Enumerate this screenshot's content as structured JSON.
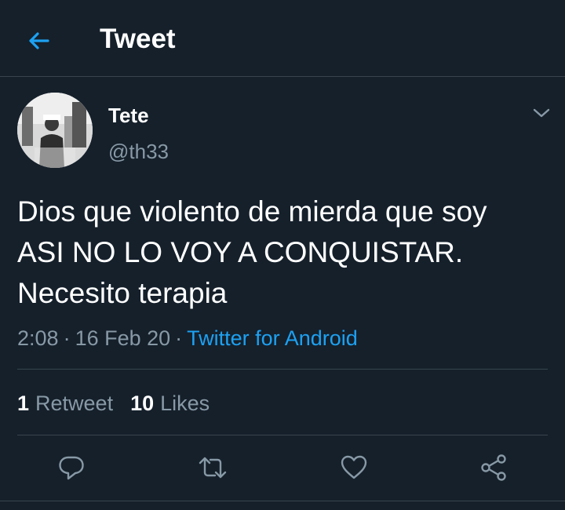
{
  "header": {
    "back_icon": "arrow-left-icon",
    "title": "Tweet"
  },
  "tweet": {
    "author_name": "Tete",
    "author_handle": "@th33",
    "text": "Dios que violento de mierda que soy\nASI NO LO VOY A CONQUISTAR.\nNecesito terapia",
    "time": "2:08",
    "date": "16 Feb 20",
    "separator": "·",
    "client": "Twitter for Android"
  },
  "stats": {
    "retweets_count": "1",
    "retweets_label": "Retweet",
    "likes_count": "10",
    "likes_label": "Likes"
  },
  "actions": [
    "reply-icon",
    "retweet-icon",
    "like-icon",
    "share-icon"
  ],
  "colors": {
    "background": "#15202b",
    "accent": "#1da1f2",
    "secondary_text": "#8899a6",
    "divider": "#38444d"
  }
}
